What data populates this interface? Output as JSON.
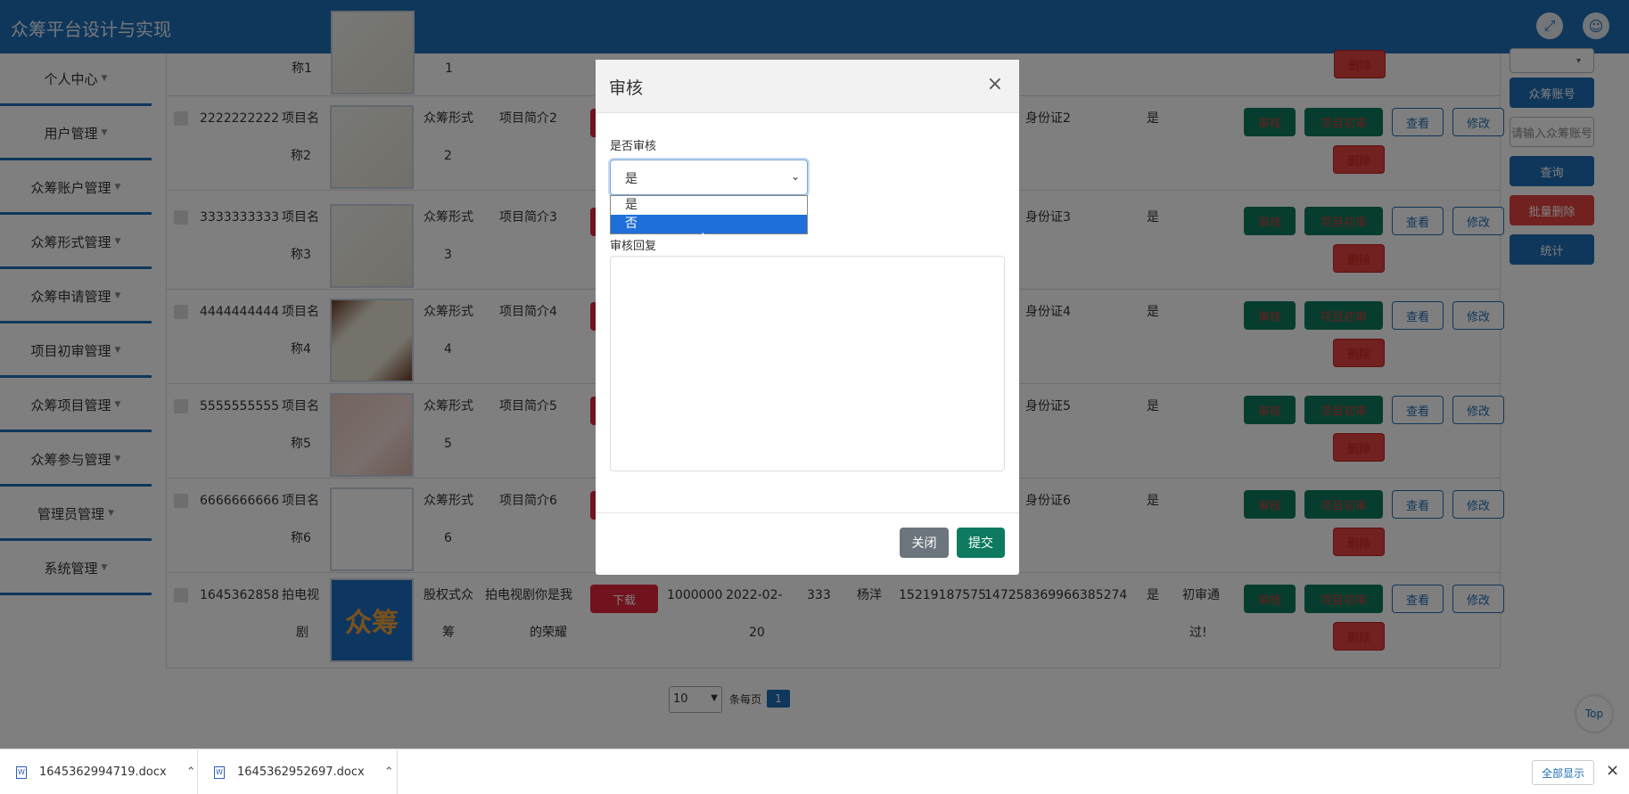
{
  "app": {
    "title": "众筹平台设计与实现"
  },
  "header_icons": [
    "fullscreen-icon",
    "user-avatar-icon"
  ],
  "sidebar": {
    "items": [
      {
        "label": "个人中心"
      },
      {
        "label": "用户管理"
      },
      {
        "label": "众筹账户管理"
      },
      {
        "label": "众筹形式管理"
      },
      {
        "label": "众筹申请管理"
      },
      {
        "label": "项目初审管理"
      },
      {
        "label": "众筹项目管理"
      },
      {
        "label": "众筹参与管理"
      },
      {
        "label": "管理员管理"
      },
      {
        "label": "系统管理"
      }
    ]
  },
  "table": {
    "top_partial": {
      "name_frag": "称1",
      "form_frag": "1"
    },
    "rows": [
      {
        "account": "2222222222",
        "name": [
          "项目名",
          "称2"
        ],
        "form": [
          "众筹形式",
          "2"
        ],
        "intro": "项目简介2",
        "idcard": "身份证2",
        "audit": "是"
      },
      {
        "account": "3333333333",
        "name": [
          "项目名",
          "称3"
        ],
        "form": [
          "众筹形式",
          "3"
        ],
        "intro": "项目简介3",
        "idcard": "身份证3",
        "audit": "是"
      },
      {
        "account": "4444444444",
        "name": [
          "项目名",
          "称4"
        ],
        "form": [
          "众筹形式",
          "4"
        ],
        "intro": "项目简介4",
        "idcard": "身份证4",
        "audit": "是"
      },
      {
        "account": "5555555555",
        "name": [
          "项目名",
          "称5"
        ],
        "form": [
          "众筹形式",
          "5"
        ],
        "intro": "项目简介5",
        "idcard": "身份证5",
        "audit": "是"
      },
      {
        "account": "6666666666",
        "name": [
          "项目名",
          "称6"
        ],
        "form": [
          "众筹形式",
          "6"
        ],
        "intro": "项目简介6",
        "idcard": "身份证6",
        "audit": "是"
      }
    ],
    "last_row": {
      "account": "1645362858",
      "name": [
        "拍电视",
        "剧"
      ],
      "form": [
        "股权式众",
        "筹"
      ],
      "intro": [
        "拍电视剧你是我",
        "的荣耀"
      ],
      "download": "下载",
      "amount": "1000000",
      "date": [
        "2022-02-",
        "20"
      ],
      "num": "333",
      "person": "杨洋",
      "phone": "15219187575",
      "idcard": "147258369966385274",
      "audit": "是",
      "reply": [
        "初审通",
        "过!"
      ],
      "logo_text": "众筹"
    },
    "row_buttons": {
      "audit": "审核",
      "first_review": "项目初审",
      "view": "查看",
      "edit": "修改",
      "delete": "删除"
    }
  },
  "right_panel": {
    "account_btn": "众筹账号",
    "search_placeholder": "请输入众筹账号",
    "query": "查询",
    "batch_delete": "批量删除",
    "stats": "统计"
  },
  "pagination": {
    "page_size": "10",
    "per_page_label": "条每页",
    "current_page": "1"
  },
  "modal": {
    "title": "审核",
    "close_x": "×",
    "audit_label": "是否审核",
    "selected": "是",
    "options": [
      "是",
      "否"
    ],
    "highlighted_option": "否",
    "reply_label": "审核回复",
    "reply_value": "",
    "close_btn": "关闭",
    "submit_btn": "提交"
  },
  "top_button": "Top",
  "downloads": {
    "files": [
      "1645362994719.docx",
      "1645362952697.docx"
    ],
    "show_all": "全部显示",
    "close": "×"
  },
  "colors": {
    "primary": "#1f6fb7",
    "success": "#0e7a5f",
    "danger": "#e2423e",
    "secondary": "#6c757d"
  }
}
